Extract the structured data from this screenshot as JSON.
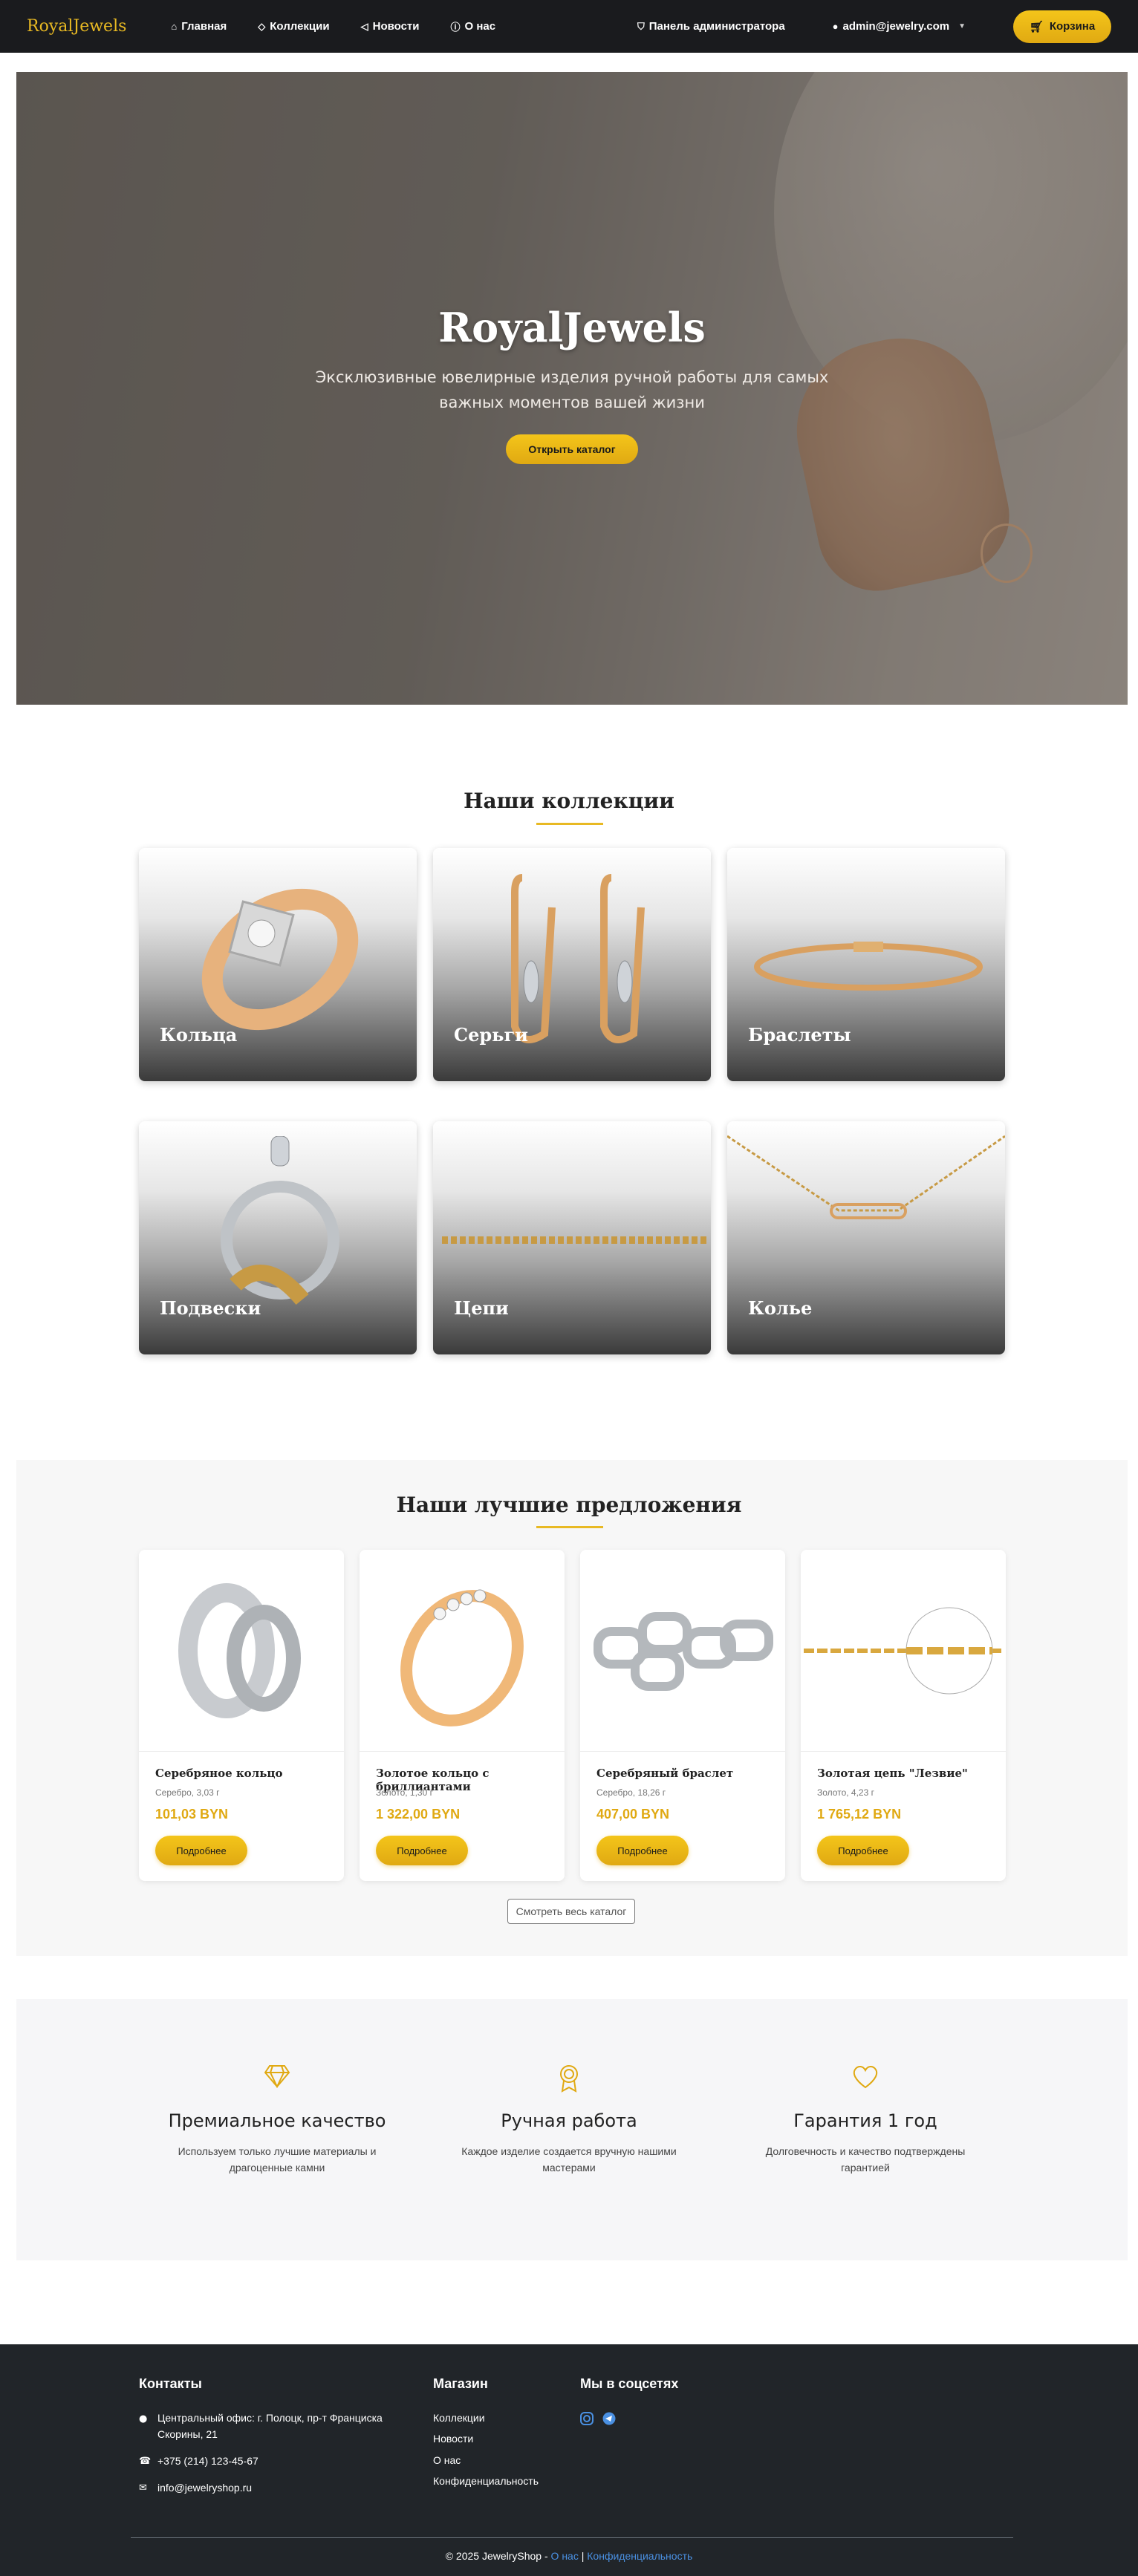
{
  "nav": {
    "brand": "RoyalJewels",
    "links": [
      {
        "label": "Главная",
        "icon": "home-icon"
      },
      {
        "label": "Коллекции",
        "icon": "gem-icon"
      },
      {
        "label": "Новости",
        "icon": "megaphone-icon"
      },
      {
        "label": "О нас",
        "icon": "info-icon"
      }
    ],
    "admin_panel": "Панель администратора",
    "user": "admin@jewelry.com",
    "cart": "Корзина",
    "accent": "#e8b923"
  },
  "hero": {
    "title": "RoyalJewels",
    "subtitle": "Эксклюзивные ювелирные изделия ручной работы для самых важных моментов вашей жизни",
    "cta": "Открыть каталог"
  },
  "collections": {
    "title": "Наши коллекции",
    "items": [
      "Кольца",
      "Серьги",
      "Браслеты",
      "Подвески",
      "Цепи",
      "Колье"
    ]
  },
  "offers": {
    "title": "Наши лучшие предложения",
    "products": [
      {
        "name": "Серебряное кольцо",
        "meta": "Серебро, 3,03 г",
        "price": "101,03 BYN",
        "button": "Подробнее"
      },
      {
        "name": "Золотое кольцо с бриллиантами",
        "meta": "Золото, 1,30 г",
        "price": "1 322,00 BYN",
        "button": "Подробнее"
      },
      {
        "name": "Серебряный браслет",
        "meta": "Серебро, 18,26 г",
        "price": "407,00 BYN",
        "button": "Подробнее"
      },
      {
        "name": "Золотая цепь \"Лезвие\"",
        "meta": "Золото, 4,23 г",
        "price": "1 765,12 BYN",
        "button": "Подробнее"
      }
    ],
    "catalog_button": "Смотреть весь каталог"
  },
  "features": [
    {
      "title": "Премиальное качество",
      "desc": "Используем только лучшие материалы и драгоценные камни",
      "icon": "diamond-icon"
    },
    {
      "title": "Ручная работа",
      "desc": "Каждое изделие создается вручную нашими мастерами",
      "icon": "award-icon"
    },
    {
      "title": "Гарантия 1 год",
      "desc": "Долговечность и качество подтверждены гарантией",
      "icon": "heart-icon"
    }
  ],
  "footer": {
    "contacts_title": "Контакты",
    "address": "Центральный офис: г. Полоцк, пр-т Франциска Скорины, 21",
    "phone": "+375 (214) 123-45-67",
    "email": "info@jewelryshop.ru",
    "shop_title": "Магазин",
    "shop_links": [
      "Коллекции",
      "Новости",
      "О нас",
      "Конфиденциальность"
    ],
    "social_title": "Мы в соцсетях",
    "copyright": "© 2025 JewelryShop -",
    "about_link": "О нас",
    "separator": "|",
    "privacy_link": "Конфиденциальность"
  }
}
